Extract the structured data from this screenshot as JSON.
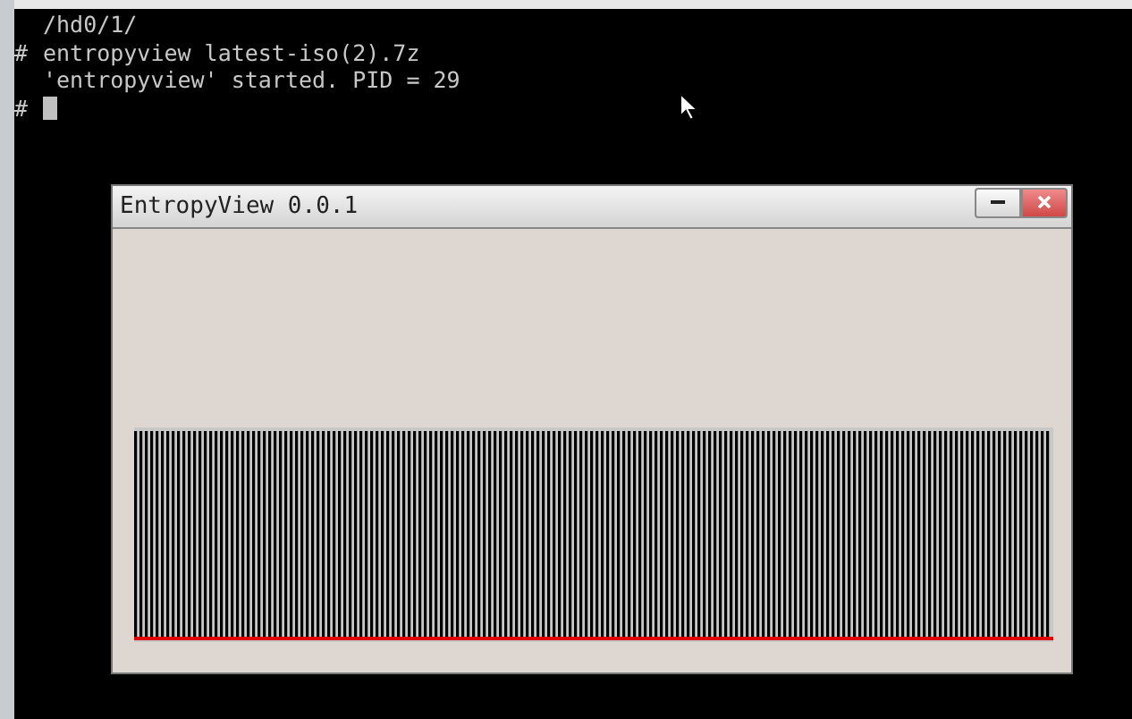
{
  "terminal": {
    "lines": [
      {
        "text": "/hd0/1/"
      },
      {
        "prompt": "#",
        "text": "entropyview latest-iso(2).7z"
      },
      {
        "text": "'entropyview' started. PID = 29"
      },
      {
        "prompt": "#"
      }
    ]
  },
  "window": {
    "title": "EntropyView 0.0.1"
  }
}
